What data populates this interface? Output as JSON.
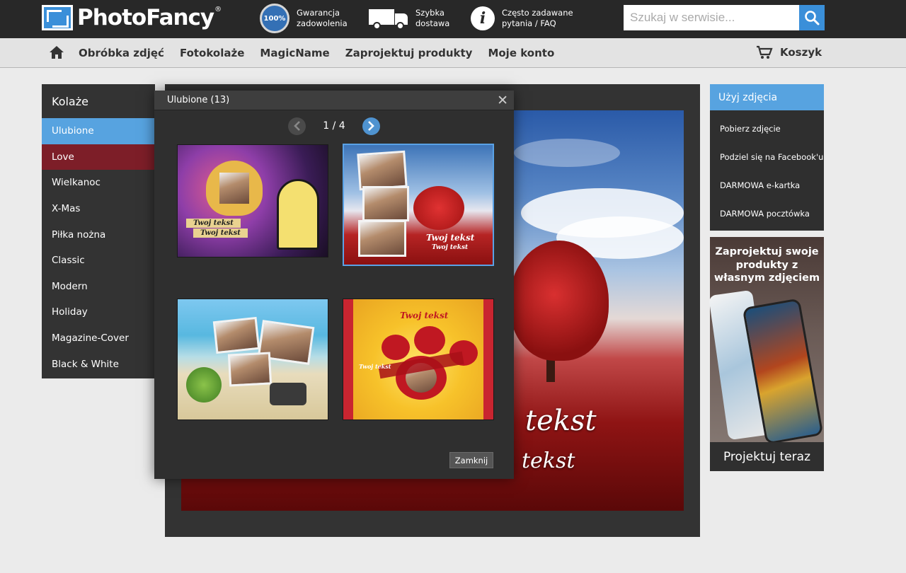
{
  "header": {
    "logo": "PhotoFancy",
    "logo_reg": "®",
    "features": [
      {
        "icon": "guarantee-seal-icon",
        "line1": "Gwarancja",
        "line2": "zadowolenia",
        "badge": "100%"
      },
      {
        "icon": "truck-icon",
        "line1": "Szybka",
        "line2": "dostawa"
      },
      {
        "icon": "info-icon",
        "line1": "Często zadawane",
        "line2": "pytania / FAQ",
        "glyph": "i"
      }
    ],
    "search_placeholder": "Szukaj w serwisie..."
  },
  "nav": {
    "items": [
      "Obróbka zdjęć",
      "Fotokolaże",
      "MagicName",
      "Zaprojektuj produkty",
      "Moje konto"
    ],
    "cart": "Koszyk"
  },
  "sidebar": {
    "title": "Kolaże",
    "items": [
      "Ulubione",
      "Love",
      "Wielkanoc",
      "X-Mas",
      "Piłka nożna",
      "Classic",
      "Modern",
      "Holiday",
      "Magazine-Cover",
      "Black & White"
    ]
  },
  "preview": {
    "text1": "tekst",
    "text2": "tekst"
  },
  "right": {
    "title": "Użyj zdjęcia",
    "options": [
      "Pobierz zdjęcie",
      "Podziel się na Facebook'u",
      "DARMOWA e-kartka",
      "DARMOWA pocztówka"
    ],
    "promo_title": "Zaprojektuj swoje produkty z własnym zdjęciem",
    "promo_button": "Projektuj teraz"
  },
  "modal": {
    "title": "Ulubione (13)",
    "close_glyph": "✕",
    "pager": "1 / 4",
    "thumbs": [
      {
        "labels": [
          "Twoj tekst",
          "Twoj tekst"
        ]
      },
      {
        "labels": [
          "Twoj tekst",
          "Twoj tekst"
        ]
      },
      {
        "labels": []
      },
      {
        "labels": [
          "Twoj tekst",
          "Twoj tekst"
        ]
      }
    ],
    "close_button": "Zamknij"
  },
  "colors": {
    "accent": "#57a3e0",
    "love": "#7d1e28",
    "dark": "#282828"
  }
}
